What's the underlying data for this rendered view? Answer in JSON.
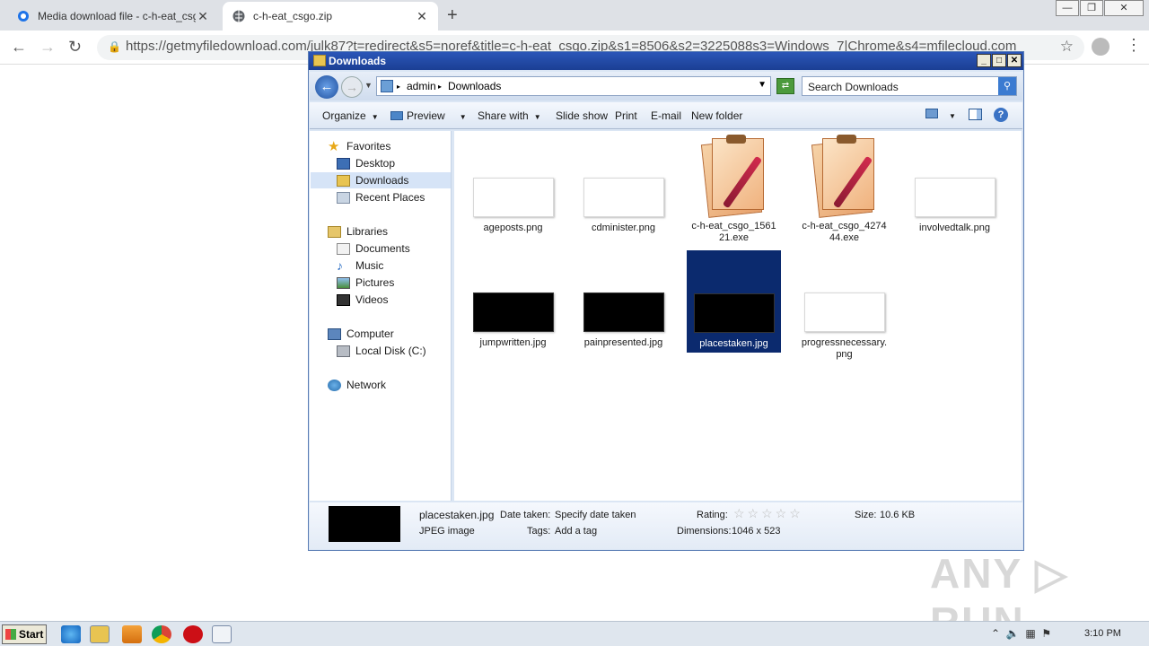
{
  "browser": {
    "tabs": [
      {
        "title": "Media download file - c-h-eat_csgo.z",
        "state": "inactive"
      },
      {
        "title": "c-h-eat_csgo.zip",
        "state": "active"
      }
    ],
    "url": "https://getmyfiledownload.com/julk87?t=redirect&s5=noref&title=c-h-eat_csgo.zip&s1=8506&s2=3225088s3=Windows_7|Chrome&s4=mfilecloud.com"
  },
  "explorer": {
    "title": "Downloads",
    "breadcrumb": [
      "admin",
      "Downloads"
    ],
    "search_placeholder": "Search Downloads",
    "commands": {
      "organize": "Organize",
      "preview": "Preview",
      "share": "Share with",
      "slideshow": "Slide show",
      "print": "Print",
      "email": "E-mail",
      "newfolder": "New folder"
    },
    "nav": {
      "favorites": "Favorites",
      "desktop": "Desktop",
      "downloads": "Downloads",
      "recent": "Recent Places",
      "libraries": "Libraries",
      "documents": "Documents",
      "music": "Music",
      "pictures": "Pictures",
      "videos": "Videos",
      "computer": "Computer",
      "localdisk": "Local Disk (C:)",
      "network": "Network"
    },
    "files": [
      {
        "name": "ageposts.png",
        "kind": "white"
      },
      {
        "name": "cdminister.png",
        "kind": "white"
      },
      {
        "name": "c-h-eat_csgo_156121.exe",
        "line1": "c-h-eat_csgo_1561",
        "line2": "21.exe",
        "kind": "exe"
      },
      {
        "name": "c-h-eat_csgo_427444.exe",
        "line1": "c-h-eat_csgo_4274",
        "line2": "44.exe",
        "kind": "exe"
      },
      {
        "name": "involvedtalk.png",
        "kind": "white"
      },
      {
        "name": "jumpwritten.jpg",
        "kind": "black"
      },
      {
        "name": "painpresented.jpg",
        "kind": "black"
      },
      {
        "name": "placestaken.jpg",
        "kind": "black",
        "selected": true
      },
      {
        "name": "progressnecessary.png",
        "line1": "progressnecessary.",
        "line2": "png",
        "kind": "white"
      }
    ],
    "details": {
      "filename": "placestaken.jpg",
      "filetype": "JPEG image",
      "date_label": "Date taken:",
      "date_value": "Specify date taken",
      "tags_label": "Tags:",
      "tags_value": "Add a tag",
      "rating_label": "Rating:",
      "dimensions_label": "Dimensions:",
      "dimensions_value": "1046 x 523",
      "size_label": "Size:",
      "size_value": "10.6 KB"
    }
  },
  "taskbar": {
    "start": "Start",
    "clock": "3:10 PM"
  },
  "watermark": "ANY RUN"
}
